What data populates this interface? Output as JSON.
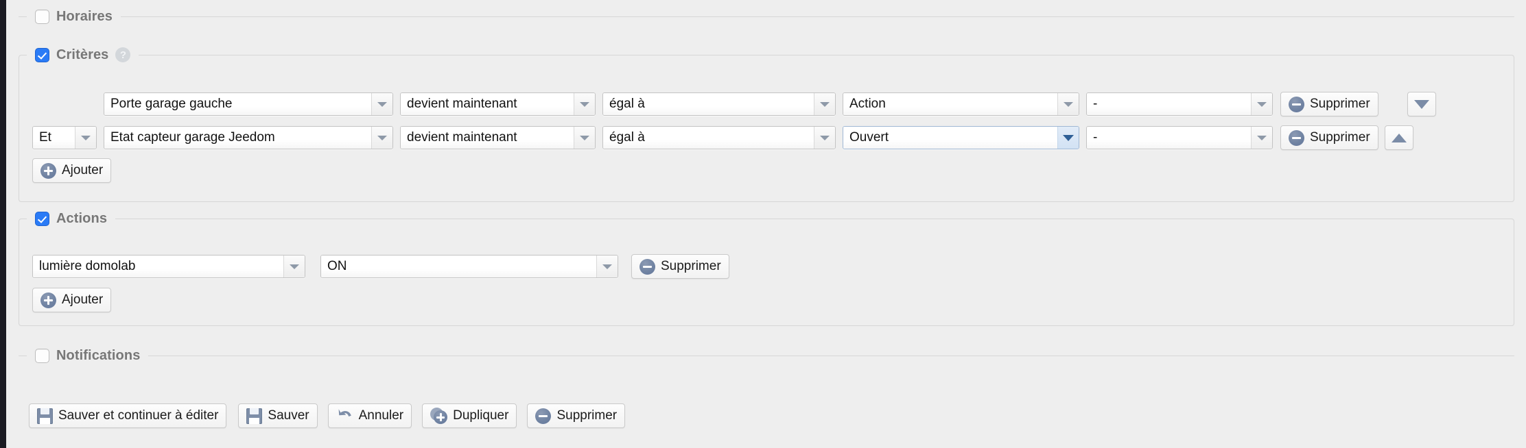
{
  "sections": {
    "horaires": {
      "label": "Horaires",
      "checked": false
    },
    "criteres": {
      "label": "Critères",
      "checked": true,
      "help_icon": "help-circle-icon"
    },
    "actions": {
      "label": "Actions",
      "checked": true
    },
    "notifications": {
      "label": "Notifications",
      "checked": false
    }
  },
  "criteria": {
    "add_label": "Ajouter",
    "rows": [
      {
        "logic": "",
        "device": "Porte garage gauche",
        "event": "devient maintenant",
        "operator": "égal à",
        "value": "Action",
        "extra": "-",
        "delete_label": "Supprimer",
        "move_icon": "triangle-down-icon"
      },
      {
        "logic": "Et",
        "device": "Etat capteur garage Jeedom",
        "event": "devient maintenant",
        "operator": "égal à",
        "value": "Ouvert",
        "extra": "-",
        "delete_label": "Supprimer",
        "move_icon": "triangle-up-icon"
      }
    ]
  },
  "actions": {
    "add_label": "Ajouter",
    "rows": [
      {
        "target": "lumière domolab",
        "command": "ON",
        "delete_label": "Supprimer"
      }
    ]
  },
  "toolbar": {
    "save_continue_label": "Sauver et continuer à éditer",
    "save_label": "Sauver",
    "cancel_label": "Annuler",
    "duplicate_label": "Dupliquer",
    "delete_label": "Supprimer"
  },
  "theme": {
    "accent_blue": "#2a7bf6",
    "icon_blue_gray": "#7184a3",
    "page_bg": "#eeeeee",
    "border": "#d6d6d6"
  }
}
